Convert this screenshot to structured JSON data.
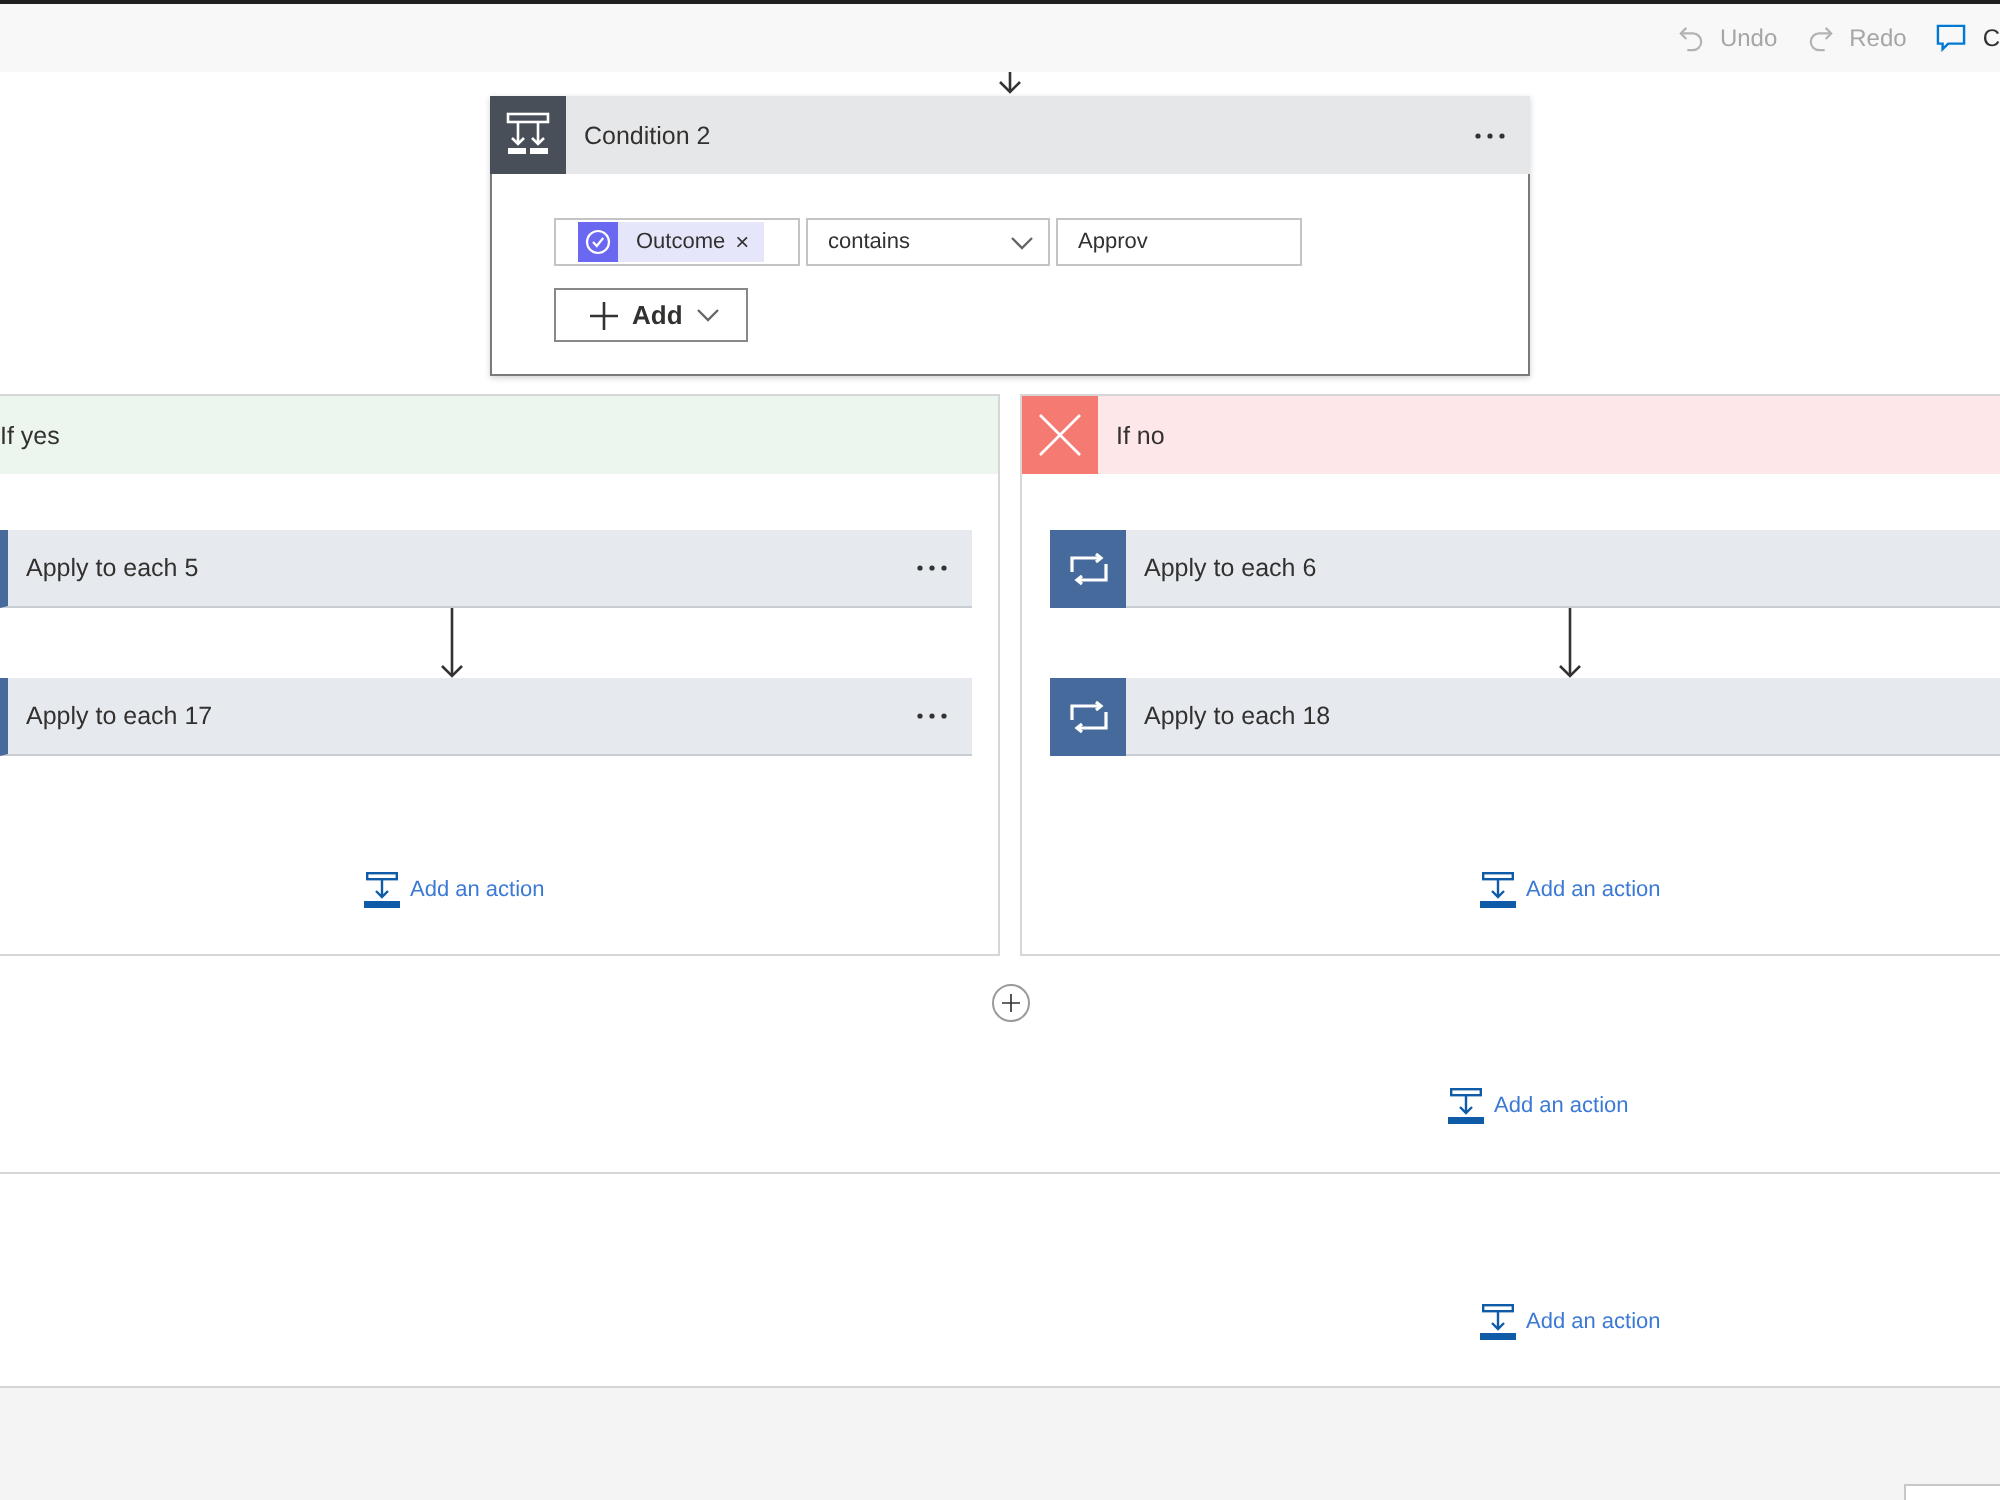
{
  "toolbar": {
    "items": [
      {
        "kind": "undo",
        "label": "Undo",
        "disabled": true
      },
      {
        "kind": "redo",
        "label": "Redo",
        "disabled": true
      },
      {
        "kind": "comment",
        "label": "C",
        "disabled": false
      }
    ]
  },
  "condition": {
    "title": "Condition 2",
    "rows": [
      {
        "token": "Outcome",
        "token_remove": "×",
        "operator": "contains",
        "value": "Approv"
      }
    ],
    "add_button": "Add"
  },
  "branches": [
    {
      "kind": "yes",
      "title": "If yes",
      "actions": [
        {
          "title": "Apply to each 5"
        },
        {
          "title": "Apply to each 17"
        }
      ],
      "add_action": "Add an action"
    },
    {
      "kind": "no",
      "title": "If no",
      "actions": [
        {
          "title": "Apply to each 6"
        },
        {
          "title": "Apply to each 18"
        }
      ],
      "add_action": "Add an action"
    }
  ],
  "scopes": [
    {
      "add_action": "Add an action"
    },
    {
      "add_action": "Add an action"
    }
  ]
}
